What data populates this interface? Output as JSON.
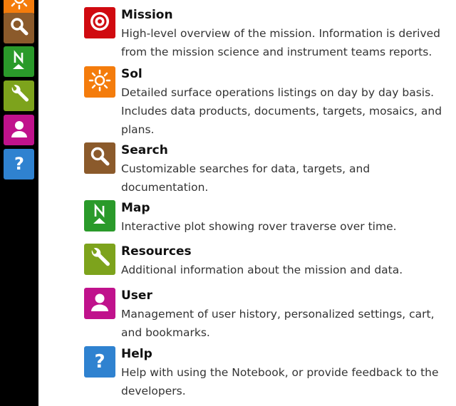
{
  "colors": {
    "sidebar_bg": "#000000",
    "mission": "#d00a10",
    "sol": "#f47c0c",
    "search": "#8b5a2b",
    "map": "#2a9a2a",
    "resources": "#7da31c",
    "user": "#c0128c",
    "help": "#2f82d0"
  },
  "sidebar": {
    "items": [
      {
        "icon": "sun-icon"
      },
      {
        "icon": "search-icon"
      },
      {
        "icon": "map-north-icon"
      },
      {
        "icon": "wrench-icon"
      },
      {
        "icon": "user-icon"
      },
      {
        "icon": "help-icon"
      }
    ]
  },
  "main": {
    "items": [
      {
        "icon": "target-icon",
        "title": "Mission",
        "lines": [
          "High-level overview of the mission. Information is derived",
          "from the mission science and instrument teams reports."
        ]
      },
      {
        "icon": "sun-icon",
        "title": "Sol",
        "lines": [
          "Detailed surface operations listings on day by day basis.",
          "Includes data products, documents, targets, mosaics, and",
          "plans."
        ]
      },
      {
        "icon": "search-icon",
        "title": "Search",
        "lines": [
          "Customizable searches for data, targets, and",
          "documentation."
        ]
      },
      {
        "icon": "map-north-icon",
        "title": "Map",
        "lines": [
          "Interactive plot showing rover traverse over time."
        ]
      },
      {
        "icon": "wrench-icon",
        "title": "Resources",
        "lines": [
          "Additional information about the mission and data."
        ]
      },
      {
        "icon": "user-icon",
        "title": "User",
        "lines": [
          "Management of user history, personalized settings, cart,",
          "and bookmarks."
        ]
      },
      {
        "icon": "help-icon",
        "title": "Help",
        "lines": [
          "Help with using the Notebook, or provide feedback to the",
          "developers."
        ]
      }
    ]
  }
}
